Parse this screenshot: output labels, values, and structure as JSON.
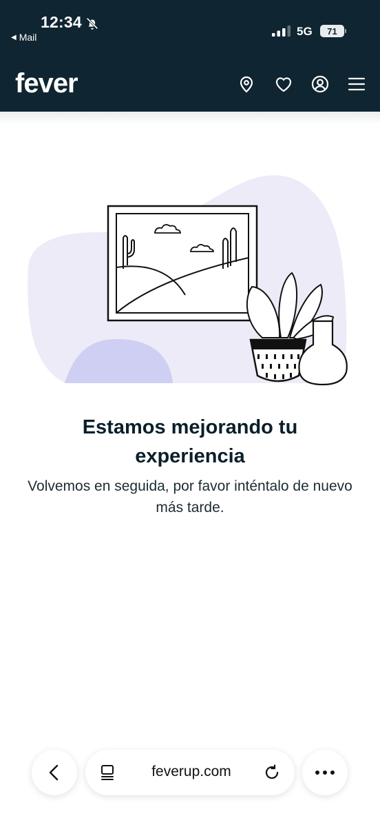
{
  "status_bar": {
    "time": "12:34",
    "back_app": "Mail",
    "network": "5G",
    "battery": "71"
  },
  "header": {
    "logo": "fever",
    "icons": [
      "location-pin-icon",
      "heart-icon",
      "user-icon",
      "menu-icon"
    ]
  },
  "main": {
    "title": "Estamos mejorando tu experiencia",
    "subtitle": "Volvemos en seguida, por favor inténtalo de nuevo más tarde."
  },
  "browser_bar": {
    "url": "feverup.com",
    "icons": [
      "back-arrow-icon",
      "tabs-icon",
      "reload-icon",
      "more-icon"
    ]
  },
  "colors": {
    "header_bg": "#0f2531",
    "blob": "#ecebf7",
    "blob_accent": "#cfcff4"
  }
}
